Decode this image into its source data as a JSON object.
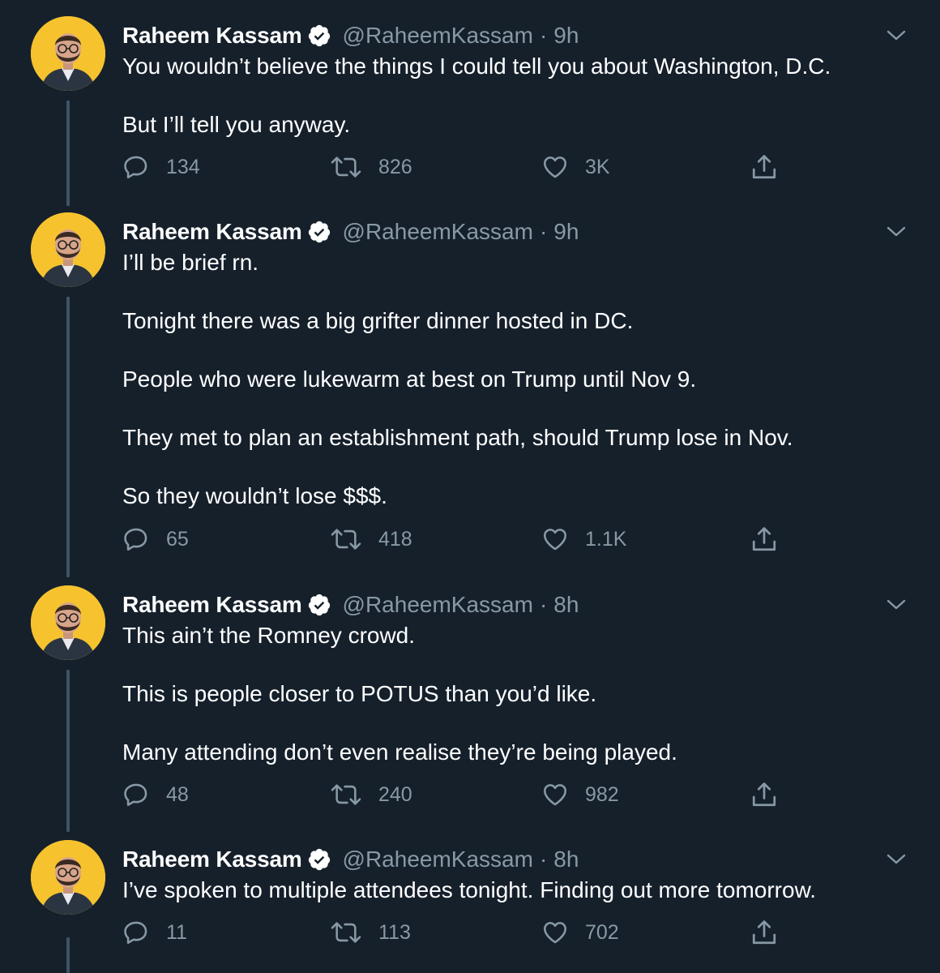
{
  "tweets": [
    {
      "author_name": "Raheem Kassam",
      "handle": "@RaheemKassam",
      "separator": "·",
      "time": "9h",
      "paragraphs": [
        "You wouldn’t believe the things I could tell you about Washington, D.C.",
        "But I’ll tell you anyway."
      ],
      "reply_count": "134",
      "retweet_count": "826",
      "like_count": "3K"
    },
    {
      "author_name": "Raheem Kassam",
      "handle": "@RaheemKassam",
      "separator": "·",
      "time": "9h",
      "paragraphs": [
        "I’ll be brief rn.",
        "Tonight there was a big grifter dinner hosted in DC.",
        "People who were lukewarm at best on Trump until Nov 9.",
        "They met to plan an establishment path, should Trump lose in Nov.",
        "So they wouldn’t lose $$$."
      ],
      "reply_count": "65",
      "retweet_count": "418",
      "like_count": "1.1K"
    },
    {
      "author_name": "Raheem Kassam",
      "handle": "@RaheemKassam",
      "separator": "·",
      "time": "8h",
      "paragraphs": [
        "This ain’t the Romney crowd.",
        "This is people closer to POTUS than you’d like.",
        "Many attending don’t even realise they’re being played."
      ],
      "reply_count": "48",
      "retweet_count": "240",
      "like_count": "982"
    },
    {
      "author_name": "Raheem Kassam",
      "handle": "@RaheemKassam",
      "separator": "·",
      "time": "8h",
      "paragraphs": [
        "I’ve spoken to multiple attendees tonight. Finding out more tomorrow."
      ],
      "reply_count": "11",
      "retweet_count": "113",
      "like_count": "702"
    }
  ],
  "colors": {
    "background": "#15202b",
    "primary_text": "#ffffff",
    "secondary_text": "#8899a6",
    "thread_line": "#3d5466",
    "avatar_background": "#f6c22e"
  },
  "icons": {
    "reply": "reply-bubble-icon",
    "retweet": "retweet-icon",
    "like": "heart-icon",
    "share": "share-icon",
    "verified": "verified-badge-icon",
    "more": "chevron-down-icon"
  }
}
